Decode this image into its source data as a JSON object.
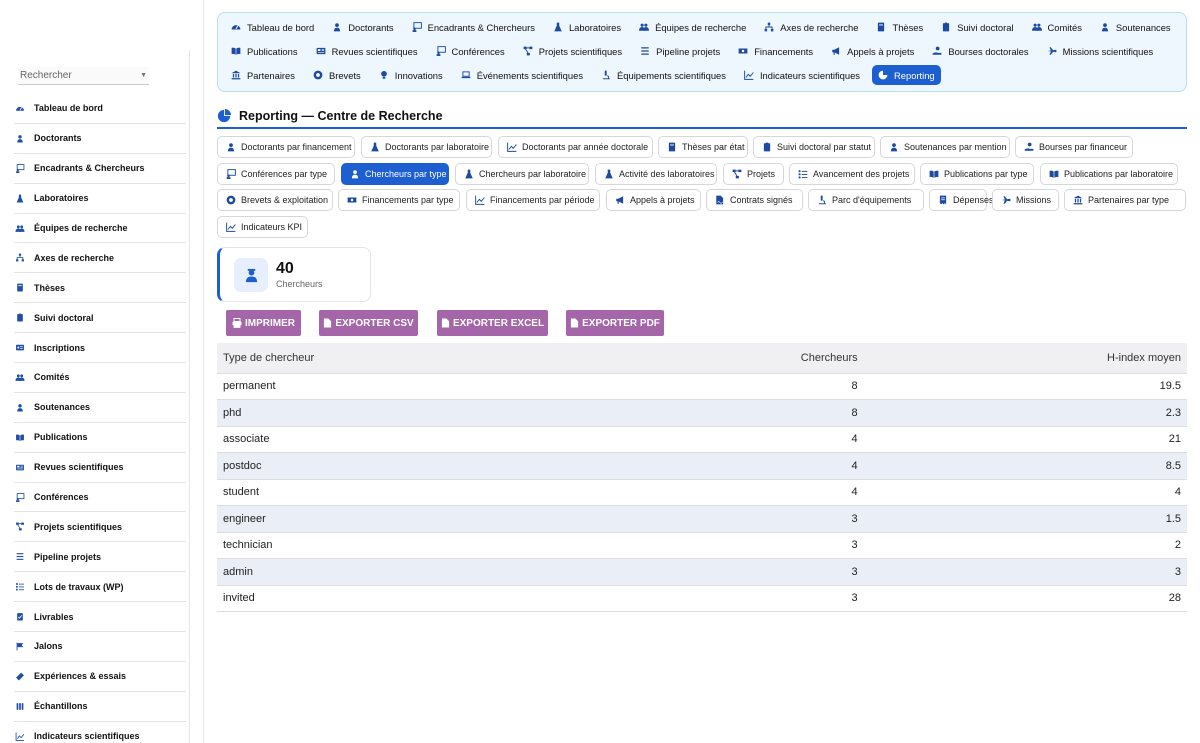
{
  "search": {
    "placeholder": "Rechercher"
  },
  "sidebar": {
    "items": [
      {
        "label": "Tableau de bord",
        "icon": "gauge-icon"
      },
      {
        "label": "Doctorants",
        "icon": "graduate-icon"
      },
      {
        "label": "Encadrants & Chercheurs",
        "icon": "chalkboard-teacher-icon"
      },
      {
        "label": "Laboratoires",
        "icon": "flask-icon"
      },
      {
        "label": "Équipes de recherche",
        "icon": "users-icon"
      },
      {
        "label": "Axes de recherche",
        "icon": "sitemap-icon"
      },
      {
        "label": "Thèses",
        "icon": "book-icon"
      },
      {
        "label": "Suivi doctoral",
        "icon": "clipboard-icon"
      },
      {
        "label": "Inscriptions",
        "icon": "id-card-icon"
      },
      {
        "label": "Comités",
        "icon": "users-icon"
      },
      {
        "label": "Soutenances",
        "icon": "graduate-icon"
      },
      {
        "label": "Publications",
        "icon": "book-open-icon"
      },
      {
        "label": "Revues scientifiques",
        "icon": "newspaper-icon"
      },
      {
        "label": "Conférences",
        "icon": "chalkboard-teacher-icon"
      },
      {
        "label": "Projets scientifiques",
        "icon": "project-diagram-icon"
      },
      {
        "label": "Pipeline projets",
        "icon": "list-icon"
      },
      {
        "label": "Lots de travaux (WP)",
        "icon": "tasks-icon"
      },
      {
        "label": "Livrables",
        "icon": "clipboard-check-icon"
      },
      {
        "label": "Jalons",
        "icon": "flag-icon"
      },
      {
        "label": "Expériences & essais",
        "icon": "vial-icon"
      },
      {
        "label": "Échantillons",
        "icon": "vials-icon"
      },
      {
        "label": "Indicateurs scientifiques",
        "icon": "chart-line-icon"
      }
    ]
  },
  "topnav": {
    "rows": [
      [
        {
          "label": "Tableau de bord",
          "icon": "gauge-icon"
        },
        {
          "label": "Doctorants",
          "icon": "graduate-icon"
        },
        {
          "label": "Encadrants & Chercheurs",
          "icon": "chalkboard-teacher-icon"
        },
        {
          "label": "Laboratoires",
          "icon": "flask-icon"
        },
        {
          "label": "Équipes de recherche",
          "icon": "users-icon"
        },
        {
          "label": "Axes de recherche",
          "icon": "sitemap-icon"
        },
        {
          "label": "Thèses",
          "icon": "book-icon"
        },
        {
          "label": "Suivi doctoral",
          "icon": "clipboard-icon"
        },
        {
          "label": "Comités",
          "icon": "users-icon"
        },
        {
          "label": "Soutenances",
          "icon": "graduate-icon"
        }
      ],
      [
        {
          "label": "Publications",
          "icon": "book-open-icon"
        },
        {
          "label": "Revues scientifiques",
          "icon": "newspaper-icon"
        },
        {
          "label": "Conférences",
          "icon": "chalkboard-teacher-icon"
        },
        {
          "label": "Projets scientifiques",
          "icon": "project-diagram-icon"
        },
        {
          "label": "Pipeline projets",
          "icon": "list-icon"
        },
        {
          "label": "Financements",
          "icon": "money-icon"
        },
        {
          "label": "Appels à projets",
          "icon": "bullhorn-icon"
        },
        {
          "label": "Bourses doctorales",
          "icon": "hand-holding-icon"
        },
        {
          "label": "Missions scientifiques",
          "icon": "plane-icon"
        }
      ],
      [
        {
          "label": "Partenaires",
          "icon": "landmark-icon"
        },
        {
          "label": "Brevets",
          "icon": "certificate-icon"
        },
        {
          "label": "Innovations",
          "icon": "lightbulb-icon"
        },
        {
          "label": "Événements scientifiques",
          "icon": "laptop-icon"
        },
        {
          "label": "Équipements scientifiques",
          "icon": "microscope-icon"
        },
        {
          "label": "Indicateurs scientifiques",
          "icon": "chart-line-icon"
        },
        {
          "label": "Reporting",
          "icon": "chart-pie-icon",
          "active": true
        }
      ]
    ]
  },
  "page": {
    "title": "Reporting — Centre de Recherche"
  },
  "report_tabs": [
    [
      {
        "label": "Doctorants par financement",
        "icon": "graduate-icon"
      },
      {
        "label": "Doctorants par laboratoire",
        "icon": "flask-icon"
      },
      {
        "label": "Doctorants par année doctorale",
        "icon": "chart-line-icon"
      },
      {
        "label": "Thèses par état",
        "icon": "book-icon"
      },
      {
        "label": "Suivi doctoral par statut",
        "icon": "clipboard-icon"
      },
      {
        "label": "Soutenances par mention",
        "icon": "graduate-icon"
      },
      {
        "label": "Bourses par financeur",
        "icon": "hand-holding-icon"
      }
    ],
    [
      {
        "label": "Conférences par type",
        "icon": "chalkboard-teacher-icon"
      },
      {
        "label": "Chercheurs par type",
        "icon": "user-graduate-icon",
        "active": true
      },
      {
        "label": "Chercheurs par laboratoire",
        "icon": "flask-icon"
      },
      {
        "label": "Activité des laboratoires",
        "icon": "flask-icon"
      },
      {
        "label": "Projets",
        "icon": "project-diagram-icon"
      },
      {
        "label": "Avancement des projets",
        "icon": "tasks-icon"
      },
      {
        "label": "Publications par type",
        "icon": "book-open-icon"
      },
      {
        "label": "Publications par laboratoire",
        "icon": "book-open-icon"
      }
    ],
    [
      {
        "label": "Brevets & exploitation",
        "icon": "certificate-icon"
      },
      {
        "label": "Financements par type",
        "icon": "money-icon"
      },
      {
        "label": "Financements par période",
        "icon": "chart-line-icon"
      },
      {
        "label": "Appels à projets",
        "icon": "bullhorn-icon"
      },
      {
        "label": "Contrats signés",
        "icon": "file-signature-icon"
      },
      {
        "label": "Parc d'équipements",
        "icon": "microscope-icon"
      },
      {
        "label": "Dépenses",
        "icon": "receipt-icon"
      },
      {
        "label": "Missions",
        "icon": "plane-icon"
      },
      {
        "label": "Partenaires par type",
        "icon": "landmark-icon"
      }
    ],
    [
      {
        "label": "Indicateurs KPI",
        "icon": "chart-line-icon"
      }
    ]
  ],
  "kpi": {
    "value": "40",
    "label": "Chercheurs",
    "icon": "user-graduate-icon"
  },
  "exports": [
    {
      "label": "IMPRIMER",
      "icon": "printer-icon"
    },
    {
      "label": "EXPORTER CSV",
      "icon": "file-icon"
    },
    {
      "label": "EXPORTER EXCEL",
      "icon": "file-icon"
    },
    {
      "label": "EXPORTER PDF",
      "icon": "file-icon"
    }
  ],
  "table": {
    "headers": [
      "Type de chercheur",
      "Chercheurs",
      "H-index moyen"
    ],
    "rows": [
      [
        "permanent",
        "8",
        "19.5"
      ],
      [
        "phd",
        "8",
        "2.3"
      ],
      [
        "associate",
        "4",
        "21"
      ],
      [
        "postdoc",
        "4",
        "8.5"
      ],
      [
        "student",
        "4",
        "4"
      ],
      [
        "engineer",
        "3",
        "1.5"
      ],
      [
        "technician",
        "3",
        "2"
      ],
      [
        "admin",
        "3",
        "3"
      ],
      [
        "invited",
        "3",
        "28"
      ]
    ]
  },
  "colors": {
    "accent": "#1d5fd1",
    "export_button": "#a466a8",
    "nav_bg": "#eef7fd",
    "row_alt": "#e9eef7"
  }
}
